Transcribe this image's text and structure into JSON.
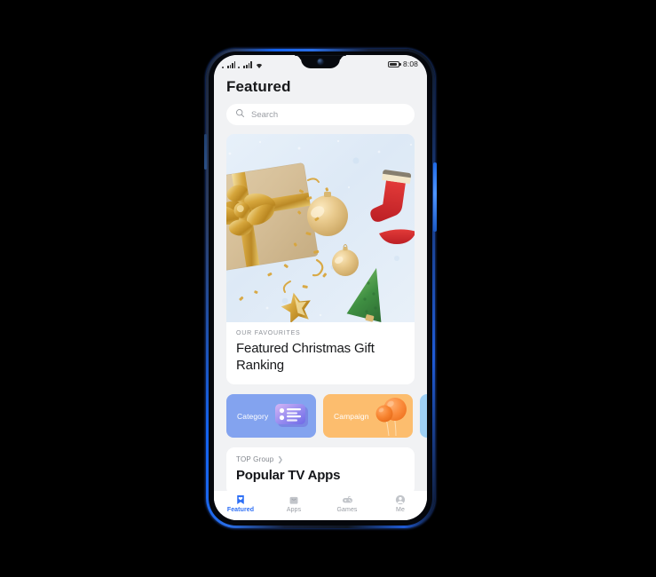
{
  "device": {
    "frame_color": "#1463f0",
    "body_color": "#101722"
  },
  "status_bar": {
    "signal_icon": "signal-bars-icon",
    "signal_icon_2": "signal-bars-icon",
    "wifi_icon": "wifi-icon",
    "battery_icon": "battery-icon",
    "time": "8:08"
  },
  "header": {
    "title": "Featured"
  },
  "search": {
    "icon": "search-icon",
    "placeholder": "Search",
    "value": ""
  },
  "hero_card": {
    "image_alt": "christmas-giftbox-flatlay",
    "kicker": "OUR FAVOURITES",
    "headline": "Featured Christmas Gift Ranking"
  },
  "tiles": [
    {
      "label": "Category",
      "color": "#83a3ef",
      "icon": "list-card-icon"
    },
    {
      "label": "Campaign",
      "color": "#fcbd6e",
      "icon": "balloons-icon"
    },
    {
      "label": "",
      "color": "#9ed0f5",
      "icon": ""
    }
  ],
  "top_group": {
    "label": "TOP Group",
    "chevron": "chevron-right-icon",
    "title": "Popular TV Apps"
  },
  "tabbar": {
    "accent": "#2c6ef5",
    "inactive": "#9a9ea5",
    "items": [
      {
        "label": "Featured",
        "icon": "bookmark-heart-icon",
        "active": true
      },
      {
        "label": "Apps",
        "icon": "shopping-bag-icon",
        "active": false
      },
      {
        "label": "Games",
        "icon": "gamepad-icon",
        "active": false
      },
      {
        "label": "Me",
        "icon": "person-icon",
        "active": false
      }
    ]
  }
}
